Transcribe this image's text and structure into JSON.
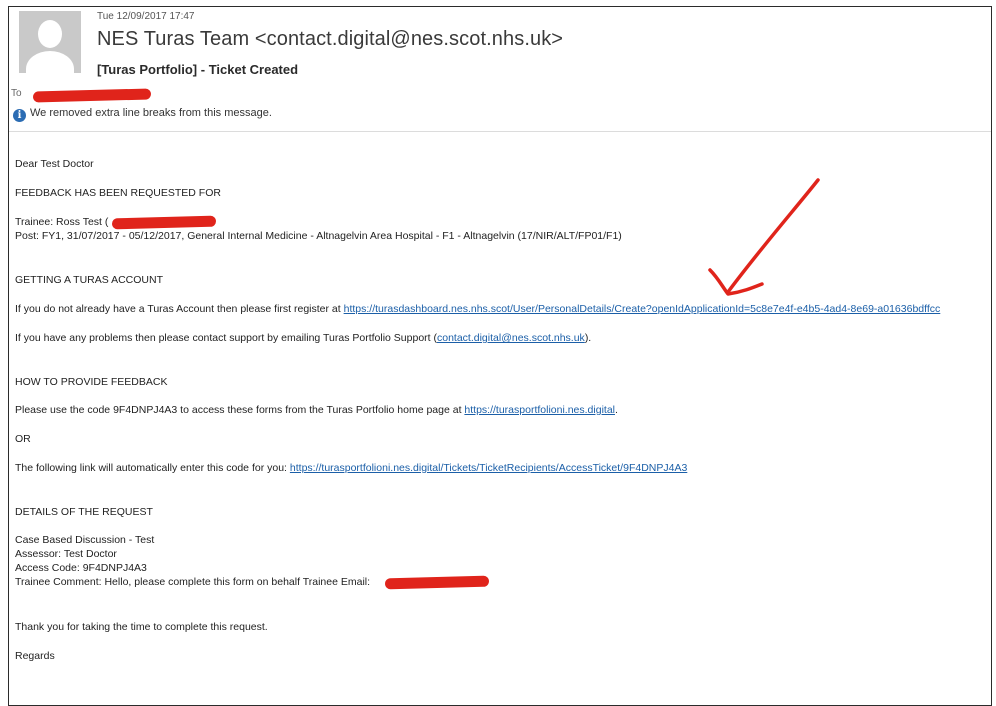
{
  "email": {
    "sent_date": "Tue 12/09/2017 17:47",
    "sender": "NES Turas Team <contact.digital@nes.scot.nhs.uk>",
    "subject": "[Turas Portfolio] - Ticket Created",
    "to_label": "To",
    "info_message": "We removed extra line breaks from this message.",
    "info_icon": "info-icon",
    "redaction_color": "#e0241b",
    "link_color": "#1b5fa8"
  },
  "body": {
    "greeting": "Dear Test Doctor",
    "section1_heading": "FEEDBACK HAS BEEN REQUESTED FOR",
    "trainee_line": "Trainee: Ross Test (",
    "post_line": "Post: FY1, 31/07/2017 - 05/12/2017, General Internal Medicine - Altnagelvin Area Hospital - F1 - Altnagelvin (17/NIR/ALT/FP01/F1)",
    "section2_heading": "GETTING A TURAS ACCOUNT",
    "register_text": "If you do not already have a Turas Account then please first register at ",
    "register_link": "https://turasdashboard.nes.nhs.scot/User/PersonalDetails/Create?openIdApplicationId=5c8e7e4f-e4b5-4ad4-8e69-a01636bdffcc",
    "support_text": "If you have any problems then please contact support by emailing Turas Portfolio Support (",
    "support_link": "contact.digital@nes.scot.nhs.uk",
    "support_end": ").",
    "section3_heading": "HOW TO PROVIDE FEEDBACK",
    "code_text": "Please use the code 9F4DNPJ4A3 to access these forms from the Turas Portfolio home page at ",
    "code_link": "https://turasportfolioni.nes.digital",
    "code_end": ".",
    "or_text": "OR",
    "auto_text": "The following link will automatically enter this code for you: ",
    "auto_link": "https://turasportfolioni.nes.digital/Tickets/TicketRecipients/AccessTicket/9F4DNPJ4A3",
    "section4_heading": "DETAILS OF THE REQUEST",
    "detail_type": "Case Based Discussion - Test",
    "detail_assessor": "Assessor: Test Doctor",
    "detail_code": "Access Code: 9F4DNPJ4A3",
    "detail_comment": "Trainee Comment: Hello, please complete this form on behalf Trainee Email:",
    "thanks": "Thank you for taking the time to complete this request.",
    "regards": "Regards"
  },
  "annotation": {
    "arrow_color": "#e0241b"
  }
}
